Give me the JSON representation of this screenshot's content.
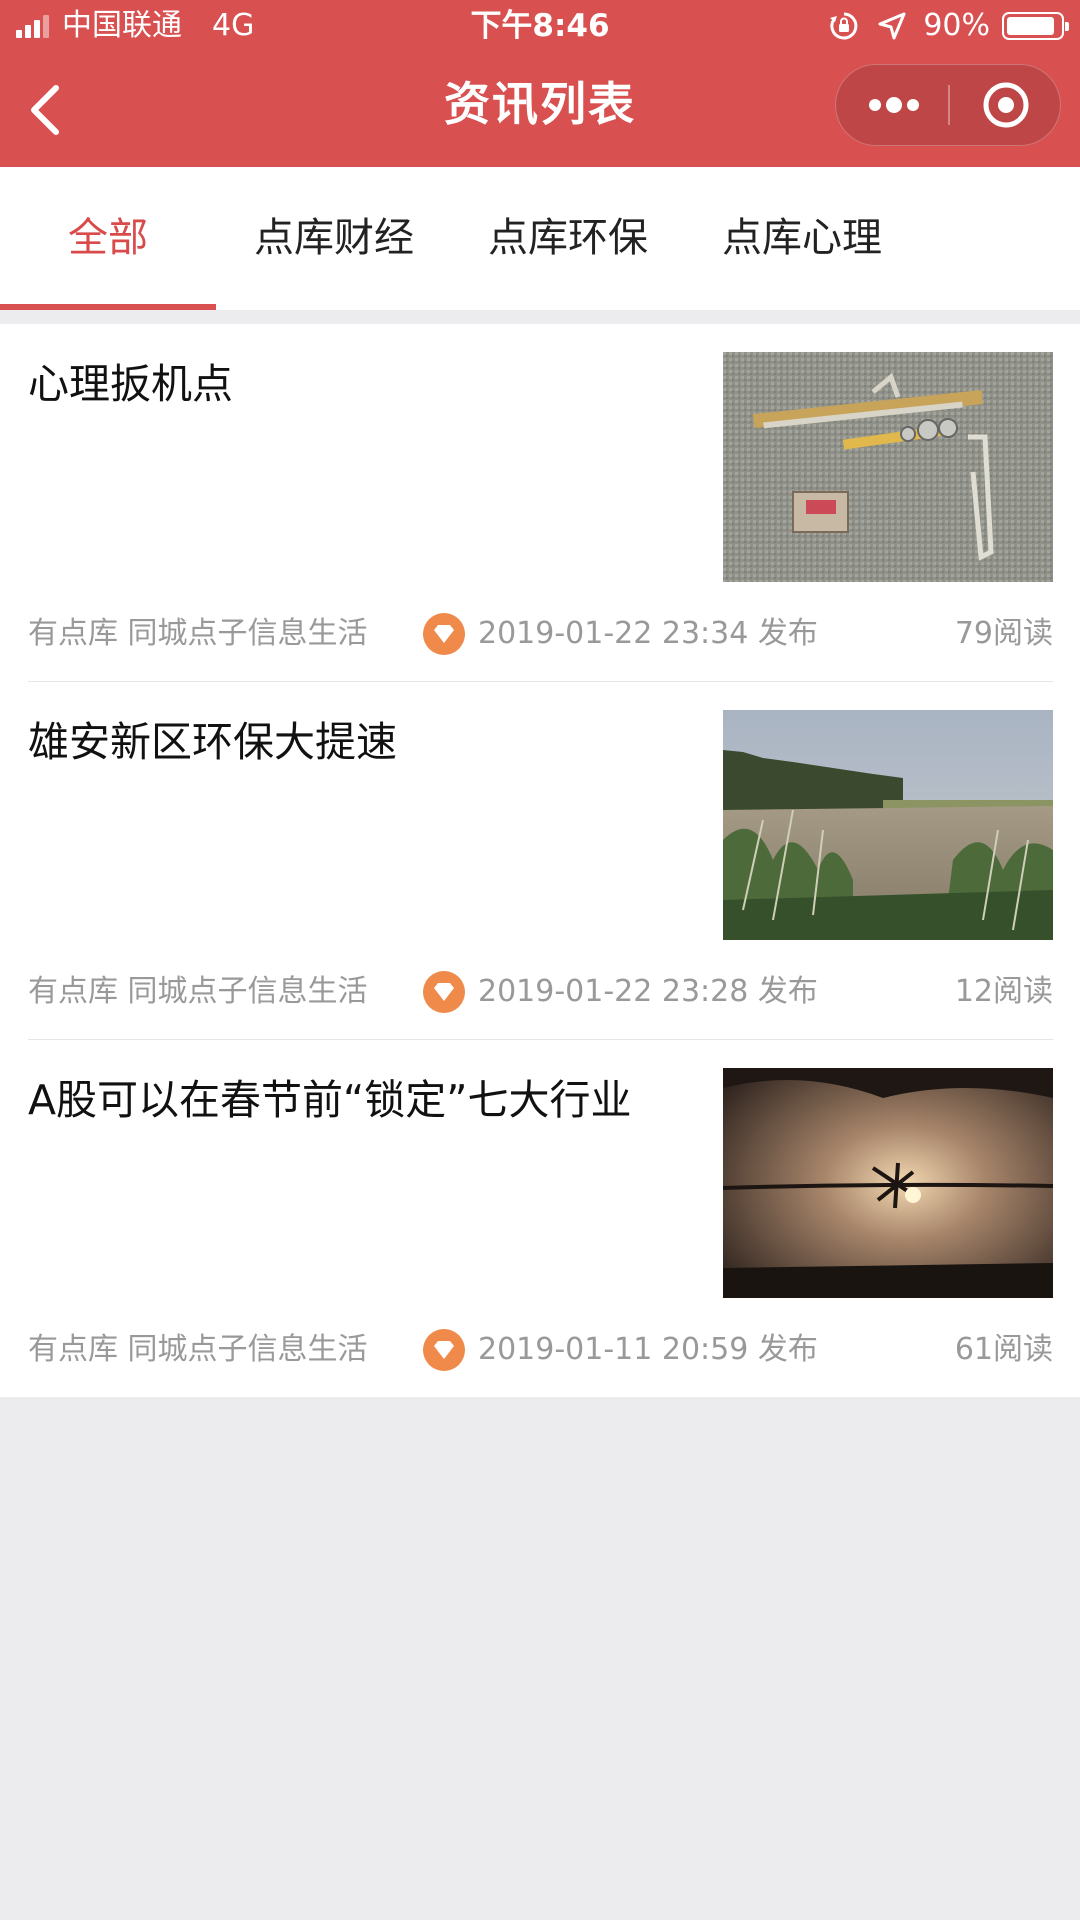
{
  "status_bar": {
    "carrier": "中国联通",
    "network": "4G",
    "time": "下午8:46",
    "battery": "90%",
    "battery_level": 0.9,
    "icons": [
      "signal-icon",
      "rotation-lock-icon",
      "location-arrow-icon",
      "battery-icon"
    ]
  },
  "nav": {
    "title": "资讯列表",
    "back_icon": "chevron-left-icon",
    "more_icon": "more-dots-icon",
    "close_icon": "target-circle-icon"
  },
  "tabs": [
    {
      "label": "全部",
      "active": true
    },
    {
      "label": "点库财经",
      "active": false
    },
    {
      "label": "点库环保",
      "active": false
    },
    {
      "label": "点库心理",
      "active": false
    }
  ],
  "articles": [
    {
      "title": "心理扳机点",
      "source": "有点库 同城点子信息生活",
      "date": "2019-01-22 23:34 发布",
      "reads": "79阅读",
      "thumbnail": "slingshot-gun-photo"
    },
    {
      "title": "雄安新区环保大提速",
      "source": "有点库 同城点子信息生活",
      "date": "2019-01-22 23:28 发布",
      "reads": "12阅读",
      "thumbnail": "river-reeds-photo"
    },
    {
      "title": "A股可以在春节前“锁定”七大行业",
      "source": "有点库 同城点子信息生活",
      "date": "2019-01-11 20:59 发布",
      "reads": "61阅读",
      "thumbnail": "barbed-wire-sunset-photo"
    }
  ],
  "colors": {
    "brand_red": "#d95050",
    "active_tab": "#d94a4a",
    "gem_orange": "#f08a4b",
    "meta_gray": "#999999",
    "page_bg": "#ececee"
  }
}
